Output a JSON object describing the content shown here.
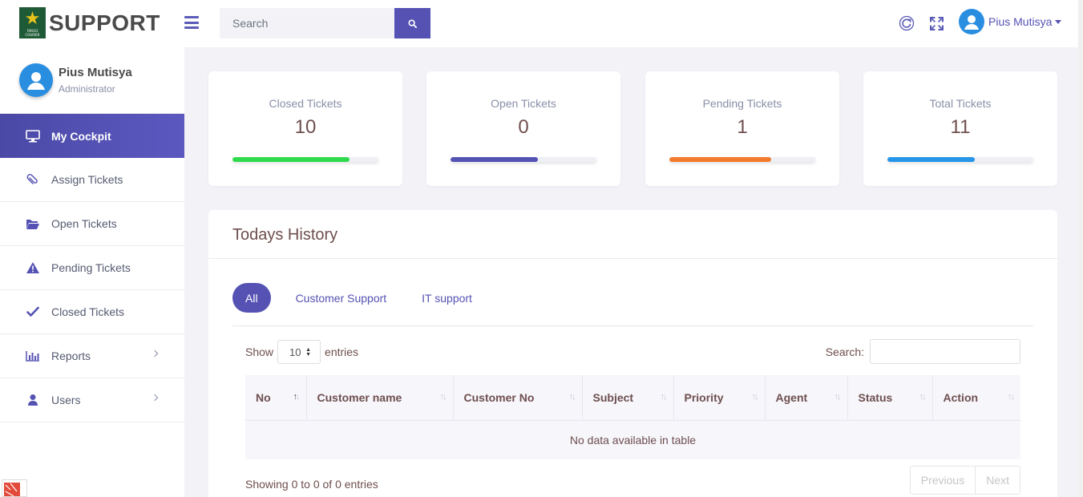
{
  "header": {
    "logo_text": "SUPPORT",
    "search_placeholder": "Search",
    "user_name": "Pius Mutisya"
  },
  "sidebar": {
    "profile": {
      "name": "Pius Mutisya",
      "role": "Administrator"
    },
    "items": [
      {
        "label": "My Cockpit",
        "icon": "monitor-icon",
        "active": true
      },
      {
        "label": "Assign Tickets",
        "icon": "paperclip-icon"
      },
      {
        "label": "Open Tickets",
        "icon": "folder-open-icon"
      },
      {
        "label": "Pending Tickets",
        "icon": "warning-icon"
      },
      {
        "label": "Closed Tickets",
        "icon": "check-icon"
      },
      {
        "label": "Reports",
        "icon": "bar-chart-icon",
        "submenu": true
      },
      {
        "label": "Users",
        "icon": "user-icon",
        "submenu": true
      }
    ]
  },
  "stats": [
    {
      "label": "Closed Tickets",
      "value": "10",
      "progress": 0.8,
      "color": "#2edb4d"
    },
    {
      "label": "Open Tickets",
      "value": "0",
      "progress": 0.6,
      "color": "#5552b3"
    },
    {
      "label": "Pending Tickets",
      "value": "1",
      "progress": 0.7,
      "color": "#f27b2d"
    },
    {
      "label": "Total Tickets",
      "value": "11",
      "progress": 0.6,
      "color": "#2596e8"
    }
  ],
  "history": {
    "title": "Todays History",
    "tabs": [
      "All",
      "Customer Support",
      "IT support"
    ],
    "show_label": "Show",
    "entries_value": "10",
    "entries_label": "entries",
    "search_label": "Search:",
    "columns": [
      "No",
      "Customer name",
      "Customer No",
      "Subject",
      "Priority",
      "Agent",
      "Status",
      "Action"
    ],
    "empty_message": "No data available in table",
    "showing": "Showing 0 to 0 of 0 entries",
    "prev_label": "Previous",
    "next_label": "Next"
  },
  "colors": {
    "accent": "#5552b3",
    "avatar": "#2a8ee0"
  }
}
